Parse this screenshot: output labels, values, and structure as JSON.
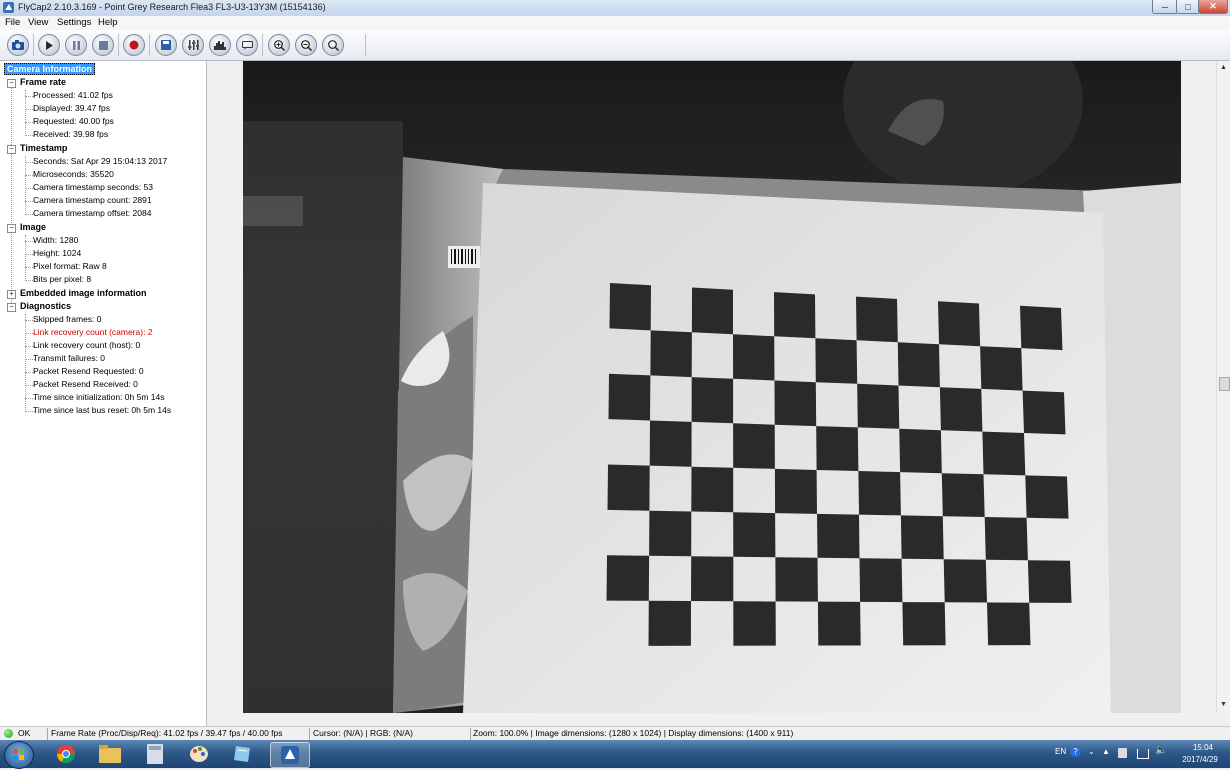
{
  "window": {
    "title": "FlyCap2 2.10.3.169 - Point Grey Research Flea3 FL3-U3-13Y3M (15154136)",
    "min_symbol": "─",
    "max_symbol": "□",
    "close_symbol": "✕"
  },
  "menu": [
    "File",
    "View",
    "Settings",
    "Help"
  ],
  "toolbar_icons": [
    "camera-select",
    "play",
    "pause",
    "stop",
    "record",
    "save",
    "settings",
    "histogram",
    "event-stats",
    "zoom-in",
    "zoom-out",
    "zoom-100"
  ],
  "tree": {
    "root": "Camera Information",
    "frame_rate": {
      "label": "Frame rate",
      "processed": "Processed: 41.02 fps",
      "displayed": "Displayed: 39.47 fps",
      "requested": "Requested: 40.00 fps",
      "received": "Received: 39.98 fps"
    },
    "timestamp": {
      "label": "Timestamp",
      "seconds": "Seconds: Sat Apr 29 15:04:13 2017",
      "microseconds": "Microseconds: 35520",
      "cam_seconds": "Camera timestamp seconds: 53",
      "cam_count": "Camera timestamp count:  2891",
      "cam_offset": "Camera timestamp offset: 2084"
    },
    "image": {
      "label": "Image",
      "width": "Width: 1280",
      "height": "Height: 1024",
      "pixel_format": "Pixel format: Raw 8",
      "bpp": "Bits per pixel:  8"
    },
    "embedded": {
      "label": "Embedded image information"
    },
    "diagnostics": {
      "label": "Diagnostics",
      "skipped": "Skipped frames: 0",
      "link_camera": "Link recovery count (camera): 2",
      "link_host": "Link recovery count (host): 0",
      "transmit": "Transmit failures: 0",
      "resend_req": "Packet Resend Requested: 0",
      "resend_recv": "Packet Resend Received: 0",
      "since_init": "Time since initialization: 0h 5m 14s",
      "since_reset": "Time since last bus reset: 0h 5m 14s"
    },
    "highlight_color": "#d00000"
  },
  "status": {
    "ok": "OK",
    "frame_rate": "Frame Rate (Proc/Disp/Req): 41.02 fps / 39.47 fps / 40.00 fps",
    "cursor": "Cursor: (N/A) | RGB: (N/A)",
    "zoom": "Zoom: 100.0% | Image dimensions: (1280 x 1024) | Display dimensions: (1400 x 911)"
  },
  "taskbar": {
    "apps": [
      "start",
      "chrome",
      "explorer",
      "calculator",
      "paint",
      "notes",
      "flycap"
    ],
    "lang": "EN",
    "time": "15:04",
    "date": "2017/4/29"
  }
}
